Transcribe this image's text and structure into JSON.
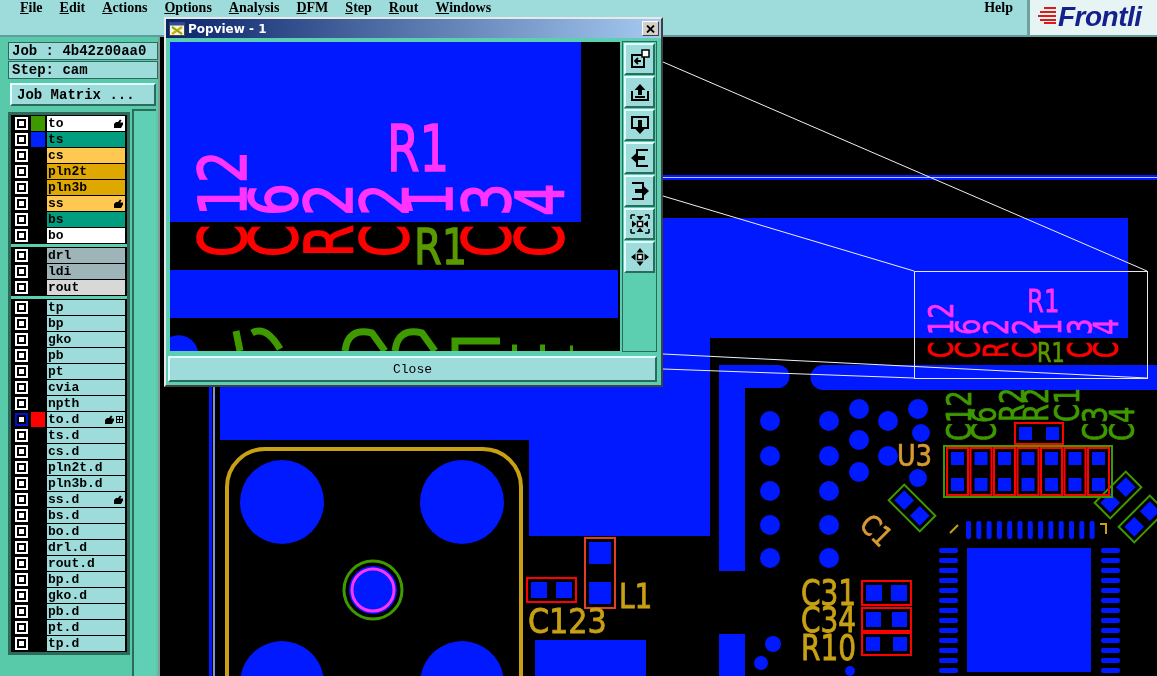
{
  "menu_bar": {
    "items": [
      "File",
      "Edit",
      "Actions",
      "Options",
      "Analysis",
      "DFM",
      "Step",
      "Rout",
      "Windows"
    ],
    "help": "Help",
    "logo_text": "Frontli"
  },
  "side_panel": {
    "job": "Job : 4b42z00aa0",
    "step": "Step: cam",
    "job_matrix_button": "Job Matrix ...",
    "layer_groups": [
      {
        "layers": [
          {
            "name": "to",
            "kind": "silk",
            "selected": false,
            "color": "#3c9a00",
            "hand": true,
            "grid": false
          },
          {
            "name": "ts",
            "kind": "mask",
            "selected": false,
            "color": "#0022ff",
            "hand": false,
            "grid": false
          },
          {
            "name": "cs",
            "kind": "signal",
            "selected": false,
            "hand": false,
            "grid": false
          },
          {
            "name": "pln2t",
            "kind": "power",
            "selected": false,
            "hand": false,
            "grid": false
          },
          {
            "name": "pln3b",
            "kind": "power",
            "selected": false,
            "hand": false,
            "grid": false
          },
          {
            "name": "ss",
            "kind": "signal",
            "selected": false,
            "hand": true,
            "grid": false
          },
          {
            "name": "bs",
            "kind": "mask",
            "selected": false,
            "hand": false,
            "grid": false
          },
          {
            "name": "bo",
            "kind": "silk",
            "selected": false,
            "hand": false,
            "grid": false
          }
        ]
      },
      {
        "layers": [
          {
            "name": "drl",
            "kind": "drill",
            "selected": false,
            "hand": false,
            "grid": false
          },
          {
            "name": "ldi",
            "kind": "drill",
            "selected": false,
            "hand": false,
            "grid": false
          },
          {
            "name": "rout",
            "kind": "rout",
            "selected": false,
            "hand": false,
            "grid": false
          }
        ]
      },
      {
        "layers": [
          {
            "name": "tp",
            "kind": "misc",
            "selected": false,
            "hand": false,
            "grid": false
          },
          {
            "name": "bp",
            "kind": "misc",
            "selected": false,
            "hand": false,
            "grid": false
          },
          {
            "name": "gko",
            "kind": "misc",
            "selected": false,
            "hand": false,
            "grid": false
          },
          {
            "name": "pb",
            "kind": "misc",
            "selected": false,
            "hand": false,
            "grid": false
          },
          {
            "name": "pt",
            "kind": "misc",
            "selected": false,
            "hand": false,
            "grid": false
          },
          {
            "name": "cvia",
            "kind": "misc",
            "selected": false,
            "hand": false,
            "grid": false
          },
          {
            "name": "npth",
            "kind": "misc",
            "selected": false,
            "hand": false,
            "grid": false
          },
          {
            "name": "to.d",
            "kind": "misc",
            "selected": true,
            "color": "#ff0000",
            "hand": true,
            "grid": true
          },
          {
            "name": "ts.d",
            "kind": "misc",
            "selected": false,
            "hand": false,
            "grid": false
          },
          {
            "name": "cs.d",
            "kind": "misc",
            "selected": false,
            "hand": false,
            "grid": false
          },
          {
            "name": "pln2t.d",
            "kind": "misc",
            "selected": false,
            "hand": false,
            "grid": false
          },
          {
            "name": "pln3b.d",
            "kind": "misc",
            "selected": false,
            "hand": false,
            "grid": false
          },
          {
            "name": "ss.d",
            "kind": "misc",
            "selected": false,
            "hand": true,
            "grid": false
          },
          {
            "name": "bs.d",
            "kind": "misc",
            "selected": false,
            "hand": false,
            "grid": false
          },
          {
            "name": "bo.d",
            "kind": "misc",
            "selected": false,
            "hand": false,
            "grid": false
          },
          {
            "name": "drl.d",
            "kind": "misc",
            "selected": false,
            "hand": false,
            "grid": false
          },
          {
            "name": "rout.d",
            "kind": "misc",
            "selected": false,
            "hand": false,
            "grid": false
          },
          {
            "name": "bp.d",
            "kind": "misc",
            "selected": false,
            "hand": false,
            "grid": false
          },
          {
            "name": "gko.d",
            "kind": "misc",
            "selected": false,
            "hand": false,
            "grid": false
          },
          {
            "name": "pb.d",
            "kind": "misc",
            "selected": false,
            "hand": false,
            "grid": false
          },
          {
            "name": "pt.d",
            "kind": "misc",
            "selected": false,
            "hand": false,
            "grid": false
          },
          {
            "name": "tp.d",
            "kind": "misc",
            "selected": false,
            "hand": false,
            "grid": false
          }
        ]
      }
    ]
  },
  "popview": {
    "title": "Popview - 1",
    "toolbar": [
      {
        "kind": "back"
      },
      {
        "kind": "up"
      },
      {
        "kind": "down"
      },
      {
        "kind": "left"
      },
      {
        "kind": "right"
      },
      {
        "kind": "zoom_in"
      },
      {
        "kind": "zoom_out"
      }
    ],
    "view": {
      "component_label": "R1",
      "pads": [
        {
          "number": "12",
          "letter": "C"
        },
        {
          "number": "6",
          "letter": "C"
        },
        {
          "number": "2",
          "letter": "R"
        },
        {
          "number": "2",
          "letter": "C"
        },
        {
          "number": "1"
        },
        {
          "number": "3",
          "letter": "C"
        },
        {
          "number": "4",
          "letter": "C"
        }
      ],
      "overlay_label": "R1"
    },
    "close_button": "Close"
  },
  "board_view": {
    "zoom_frame": {
      "component_label": "R1",
      "pads": [
        {
          "number": "12",
          "letter": "C"
        },
        {
          "number": "6",
          "letter": "C"
        },
        {
          "number": "2",
          "letter": "R"
        },
        {
          "number": "2",
          "letter": "C"
        },
        {
          "number": "1"
        },
        {
          "number": "3",
          "letter": "C"
        },
        {
          "number": "4",
          "letter": "C"
        }
      ],
      "overlay_label": "R1"
    },
    "labels": [
      {
        "text": "C12",
        "color": "#3f9a00"
      },
      {
        "text": "C6",
        "color": "#3f9a00"
      },
      {
        "text": "R2",
        "color": "#3f9a00"
      },
      {
        "text": "R2",
        "color": "#3f9a00"
      },
      {
        "text": "C1",
        "color": "#3f9a00"
      },
      {
        "text": "C3",
        "color": "#3f9a00"
      },
      {
        "text": "C4",
        "color": "#3f9a00"
      },
      {
        "text": "U3",
        "color": "#d89a30"
      },
      {
        "text": "C1",
        "color": "#d89a30"
      },
      {
        "text": "C123",
        "color": "#c8a014"
      },
      {
        "text": "L1",
        "color": "#c8a014"
      },
      {
        "text": "C31",
        "color": "#c8a014"
      },
      {
        "text": "C34",
        "color": "#c8a014"
      },
      {
        "text": "R10",
        "color": "#c8a014"
      }
    ]
  }
}
